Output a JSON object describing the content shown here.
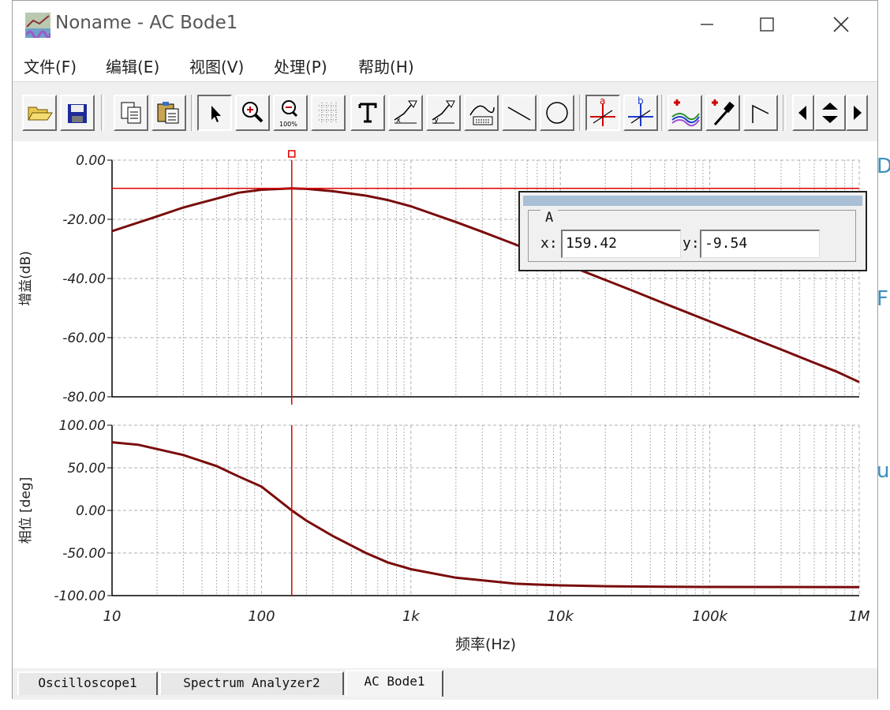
{
  "window": {
    "title": "Noname - AC Bode1"
  },
  "menu": [
    "文件(F)",
    "编辑(E)",
    "视图(V)",
    "处理(P)",
    "帮助(H)"
  ],
  "toolbar": {
    "buttons": [
      {
        "name": "open-icon"
      },
      {
        "name": "save-icon"
      },
      {
        "name": "copy-icon"
      },
      {
        "name": "paste-icon"
      },
      {
        "name": "pointer-icon"
      },
      {
        "name": "zoom-in-icon"
      },
      {
        "name": "zoom-100-icon"
      },
      {
        "name": "grid-icon"
      },
      {
        "name": "text-icon"
      },
      {
        "name": "label-x-icon"
      },
      {
        "name": "label-y-icon"
      },
      {
        "name": "label-xy-icon"
      },
      {
        "name": "line-icon"
      },
      {
        "name": "circle-icon"
      },
      {
        "name": "cursor-a-icon"
      },
      {
        "name": "cursor-b-icon"
      },
      {
        "name": "add-curve-icon"
      },
      {
        "name": "add-probe-icon"
      },
      {
        "name": "marker-icon"
      },
      {
        "name": "left-arrow-icon"
      },
      {
        "name": "updown-arrow-icon"
      },
      {
        "name": "right-arrow-icon"
      }
    ],
    "zoom_label": "100%"
  },
  "cursor_panel": {
    "group": "A",
    "x_label": "x:",
    "x_value": "159.42",
    "y_label": "y:",
    "y_value": "-9.54"
  },
  "chart_data": [
    {
      "type": "line",
      "ylabel": "增益(dB)",
      "x_scale": "log",
      "xlim": [
        10,
        1000000
      ],
      "ylim": [
        -80,
        0
      ],
      "yticks": [
        "0.00",
        "-20.00",
        "-40.00",
        "-60.00",
        "-80.00"
      ],
      "grid": true,
      "cursor_x": 159.42,
      "cursor_y": -9.54,
      "color": "#7a0c0c",
      "series": [
        {
          "x": [
            10,
            20,
            30,
            50,
            70,
            100,
            159.42,
            200,
            300,
            500,
            700,
            1000,
            2000,
            3000,
            5000,
            7000,
            10000,
            20000,
            30000,
            50000,
            70000,
            100000,
            200000,
            300000,
            500000,
            700000,
            1000000
          ],
          "y": [
            -24,
            -19,
            -16,
            -13,
            -11,
            -10,
            -9.54,
            -9.7,
            -10.5,
            -12,
            -13.5,
            -15.6,
            -20.9,
            -24.2,
            -28.5,
            -31.4,
            -34.5,
            -40.5,
            -44,
            -48.5,
            -51.4,
            -54.5,
            -60.5,
            -64,
            -68.5,
            -71.4,
            -75
          ]
        }
      ]
    },
    {
      "type": "line",
      "ylabel": "相位 [deg]",
      "xlabel": "频率(Hz)",
      "x_scale": "log",
      "xlim": [
        10,
        1000000
      ],
      "ylim": [
        -100,
        100
      ],
      "xticks": [
        "10",
        "100",
        "1k",
        "10k",
        "100k",
        "1M"
      ],
      "yticks": [
        "100.00",
        "50.00",
        "0.00",
        "-50.00",
        "-100.00"
      ],
      "grid": true,
      "cursor_x": 159.42,
      "color": "#7a0c0c",
      "series": [
        {
          "x": [
            10,
            15,
            20,
            30,
            50,
            70,
            100,
            159.42,
            200,
            300,
            500,
            700,
            1000,
            2000,
            3000,
            5000,
            7000,
            10000,
            20000,
            50000,
            100000,
            1000000
          ],
          "y": [
            80,
            77,
            72,
            65,
            52,
            40,
            28,
            0,
            -12,
            -30,
            -50,
            -61,
            -69,
            -79,
            -82,
            -86,
            -87,
            -88,
            -89,
            -89.6,
            -89.8,
            -90
          ]
        }
      ]
    }
  ],
  "tabs": [
    "Oscilloscope1",
    "Spectrum Analyzer2",
    "AC Bode1"
  ],
  "colors": {
    "trace": "#7a0c0c",
    "cursor": "#e00000",
    "grid": "#b0b0b0"
  }
}
